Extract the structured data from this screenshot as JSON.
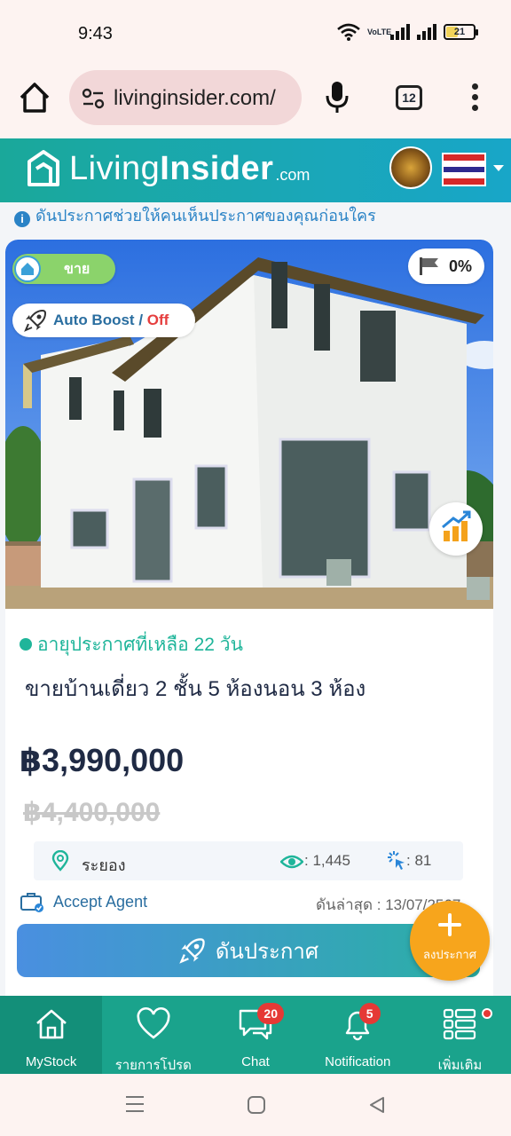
{
  "status_bar": {
    "time": "9:43",
    "battery": "21",
    "volte": "VoLTE"
  },
  "browser": {
    "url": "livinginsider.com/",
    "tab_count": "12"
  },
  "site": {
    "logo_light": "Living",
    "logo_bold": "Insider",
    "logo_suffix": ".com"
  },
  "hint": {
    "text": "ดันประกาศช่วยให้คนเห็นประกาศของคุณก่อนใคร"
  },
  "listing": {
    "type_label": "ขาย",
    "boost_pct": "0%",
    "auto_boost": "Auto Boost",
    "auto_boost_sep": " / ",
    "auto_boost_state": "Off",
    "expiry": "อายุประกาศที่เหลือ 22 วัน",
    "title": "ขายบ้านเดี่ยว 2 ชั้น 5 ห้องนอน 3 ห้อง",
    "price": "฿3,990,000",
    "old_price": "฿4,400,000",
    "location": "ระยอง",
    "views": ":   1,445",
    "clicks": ":   81",
    "agent": "Accept Agent",
    "last_push": "ดันล่าสุด : 13/07/2567",
    "push_button": "ดันประกาศ"
  },
  "fab": {
    "label": "ลงประกาศ"
  },
  "bottom_nav": [
    {
      "label": "MyStock",
      "icon": "home-icon",
      "active": true
    },
    {
      "label": "รายการโปรด",
      "icon": "heart-icon"
    },
    {
      "label": "Chat",
      "icon": "chat-icon",
      "badge": "20"
    },
    {
      "label": "Notification",
      "icon": "bell-icon",
      "badge": "5"
    },
    {
      "label": "เพิ่มเติม",
      "icon": "more-list-icon",
      "dot": true
    }
  ],
  "colors": {
    "brand_teal": "#1aa38c",
    "accent_orange": "#f7a51c",
    "badge_red": "#e53935",
    "price_navy": "#1f2a44"
  }
}
